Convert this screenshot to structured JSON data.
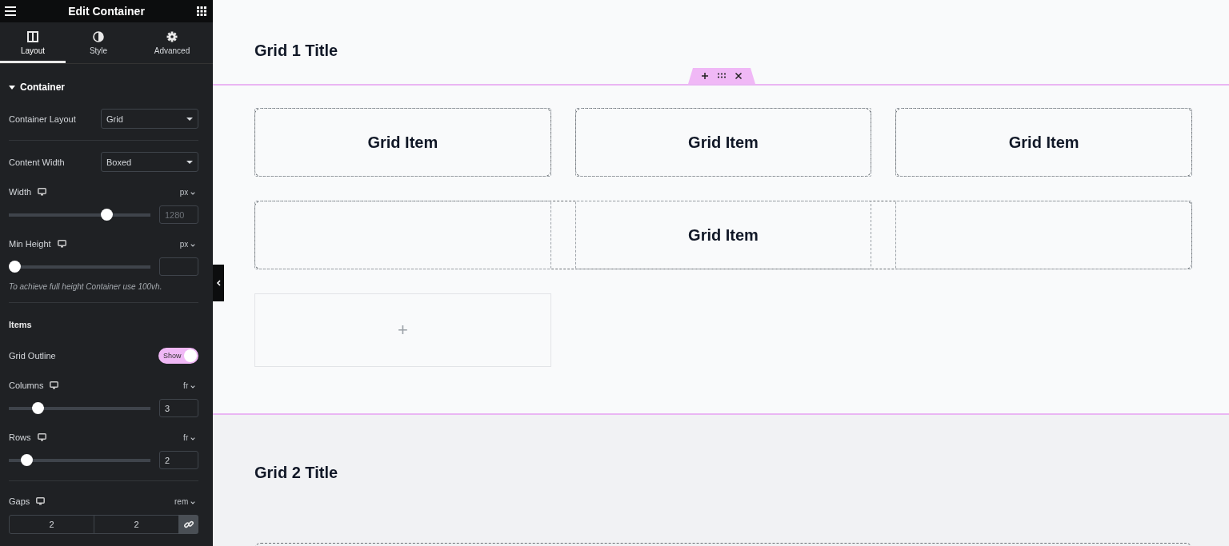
{
  "panel": {
    "title": "Edit Container",
    "tabs": [
      {
        "label": "Layout",
        "selected": true
      },
      {
        "label": "Style",
        "selected": false
      },
      {
        "label": "Advanced",
        "selected": false
      }
    ],
    "section": {
      "title": "Container",
      "expanded": true
    },
    "controls": [
      {
        "kind": "select",
        "label": "Container Layout",
        "value": "Grid"
      },
      {
        "kind": "divider"
      },
      {
        "kind": "select",
        "label": "Content Width",
        "value": "Boxed"
      },
      {
        "kind": "slider",
        "label": "Width",
        "unit": "px",
        "level": 0.71,
        "placeholder": "1280"
      },
      {
        "kind": "slider",
        "label": "Min Height",
        "unit": "px",
        "level": 0
      },
      {
        "kind": "note",
        "text": "To achieve full height Container use 100vh."
      },
      {
        "kind": "divider"
      },
      {
        "kind": "heading",
        "label": "Items"
      },
      {
        "kind": "toggle",
        "label": "Grid Outline",
        "on": true,
        "state_label": "Show"
      },
      {
        "kind": "slider",
        "label": "Columns",
        "unit": "fr",
        "level": 0.18,
        "value": "3"
      },
      {
        "kind": "slider",
        "label": "Rows",
        "unit": "fr",
        "level": 0.09,
        "value": "2"
      },
      {
        "kind": "divider"
      },
      {
        "kind": "gaps",
        "label": "Gaps",
        "unit": "rem",
        "values": [
          "2",
          "2"
        ],
        "linked": true
      }
    ]
  },
  "canvas": {
    "sections": [
      {
        "title": "Grid 1 Title",
        "selected": true,
        "grid_outline": true,
        "items": [
          {
            "label": "Grid Item",
            "kind": "cell"
          },
          {
            "label": "Grid Item",
            "kind": "cell"
          },
          {
            "label": "Grid Item",
            "kind": "cell"
          },
          {
            "label": "Grid Item",
            "kind": "full_row"
          }
        ],
        "add_slot": "+"
      },
      {
        "title": "Grid 2 Title",
        "selected": false
      }
    ]
  }
}
